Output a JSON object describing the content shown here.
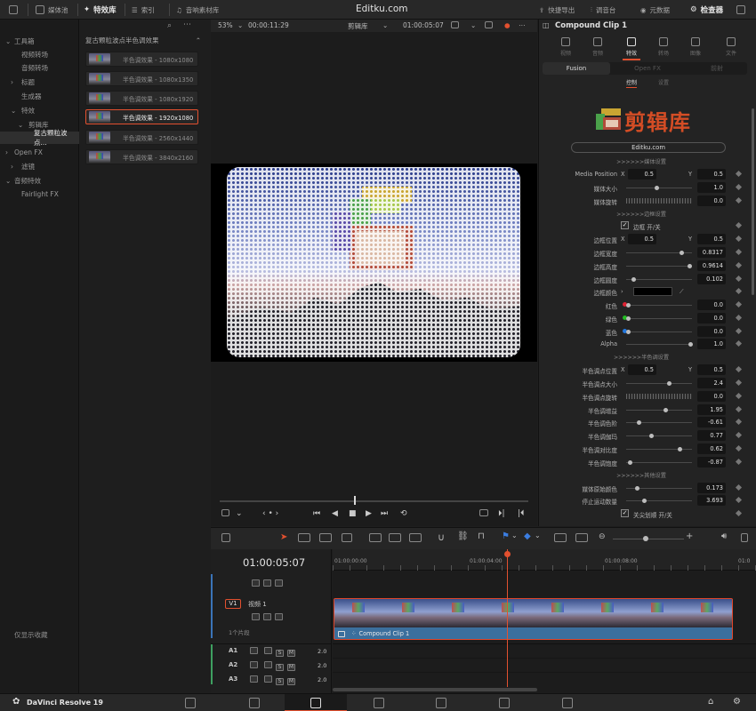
{
  "app": {
    "title": "Editku.com",
    "product": "DaVinci Resolve 19"
  },
  "topbar": {
    "media_pool": "媒体池",
    "effects_library": "特效库",
    "index": "索引",
    "sound_library": "音响素材库",
    "quick_export": "快捷导出",
    "mixer": "调音台",
    "metadata": "元数据",
    "inspector": "检查器"
  },
  "sidebar": {
    "items": [
      {
        "label": "工具箱",
        "arrow": "⌄"
      },
      {
        "label": "视频转场"
      },
      {
        "label": "音频转场"
      },
      {
        "label": "标题",
        "arrow": "›"
      },
      {
        "label": "生成器"
      },
      {
        "label": "特效",
        "arrow": "⌄"
      },
      {
        "label": "剪辑库",
        "arrow": "⌄"
      },
      {
        "label": "复古颗粒波点..."
      },
      {
        "label": "Open FX",
        "arrow": "›"
      },
      {
        "label": "滤镜",
        "arrow": "›"
      },
      {
        "label": "音频特效",
        "arrow": "⌄"
      },
      {
        "label": "Fairlight FX"
      }
    ],
    "favorites_label": "仅显示收藏"
  },
  "effects": {
    "header": "复古颗粒波点半色调效果",
    "items": [
      "半色调效果 - 1080x1080",
      "半色调效果 - 1080x1350",
      "半色调效果 - 1080x1920",
      "半色调效果 - 1920x1080",
      "半色调效果 - 2560x1440",
      "半色调效果 - 3840x2160"
    ],
    "selected_index": 3
  },
  "viewer": {
    "zoom": "53%",
    "duration": "00:00:11:29",
    "source": "剪辑库",
    "timecode": "01:00:05:07"
  },
  "inspector": {
    "clip_name": "Compound Clip 1",
    "tabs": [
      "视频",
      "音频",
      "特效",
      "转场",
      "图像",
      "文件"
    ],
    "active_tab": "特效",
    "subtabs": [
      "Fusion",
      "Open FX",
      "前射"
    ],
    "control_tabs": [
      "控制",
      "设置"
    ],
    "brand_text": "剪辑库",
    "brand_url": "Editku.com",
    "sections": {
      "media": ">>>>>>媒体设置",
      "border": ">>>>>>边框设置",
      "halftone": ">>>>>>半色调设置",
      "other": ">>>>>>其他设置"
    },
    "params": {
      "media_position_label": "Media Position",
      "media_position_x": "0.5",
      "media_position_y": "0.5",
      "media_size_label": "媒体大小",
      "media_size": "1.0",
      "media_rotation_label": "媒体旋转",
      "media_rotation": "0.0",
      "border_toggle_label": "边框 开/关",
      "border_position_label": "边框位置",
      "border_position_x": "0.5",
      "border_position_y": "0.5",
      "border_width_label": "边框宽度",
      "border_width": "0.8317",
      "border_height_label": "边框高度",
      "border_height": "0.9614",
      "border_radius_label": "边框圆度",
      "border_radius": "0.102",
      "border_color_label": "边框颜色",
      "red_label": "红色",
      "red": "0.0",
      "green_label": "绿色",
      "green": "0.0",
      "blue_label": "蓝色",
      "blue": "0.0",
      "alpha_label": "Alpha",
      "alpha": "1.0",
      "ht_position_label": "半色调点位置",
      "ht_position_x": "0.5",
      "ht_position_y": "0.5",
      "ht_size_label": "半色调点大小",
      "ht_size": "2.4",
      "ht_rotation_label": "半色调点旋转",
      "ht_rotation": "0.0",
      "ht_gain_label": "半色调增益",
      "ht_gain": "1.95",
      "ht_lift_label": "半色调色阶",
      "ht_lift": "-0.61",
      "ht_gamma_label": "半色调伽玛",
      "ht_gamma": "0.77",
      "ht_contrast_label": "半色调对比度",
      "ht_contrast": "0.62",
      "ht_saturation_label": "半色调饱度",
      "ht_saturation": "-0.87",
      "media_color_label": "媒体原始颜色",
      "media_color": "0.173",
      "motion_blur_label": "停止运动数量",
      "motion_blur": "3.693",
      "clip_toggle_label": "关尖划顺 开/关"
    }
  },
  "timeline": {
    "timecode": "01:00:05:07",
    "ruler": [
      "01:00:00:00",
      "01:00:04:00",
      "01:00:08:00",
      "01:0"
    ],
    "video_track": {
      "id": "V1",
      "name": "视频 1",
      "count": "1个片段"
    },
    "audio_tracks": [
      {
        "id": "A1",
        "level": "2.0"
      },
      {
        "id": "A2",
        "level": "2.0"
      },
      {
        "id": "A3",
        "level": "2.0"
      }
    ],
    "clip_label": "Compound Clip 1"
  },
  "colors": {
    "accent": "#e2502f",
    "clip_blue": "#3b6f9d",
    "bg": "#1e1e1e"
  }
}
